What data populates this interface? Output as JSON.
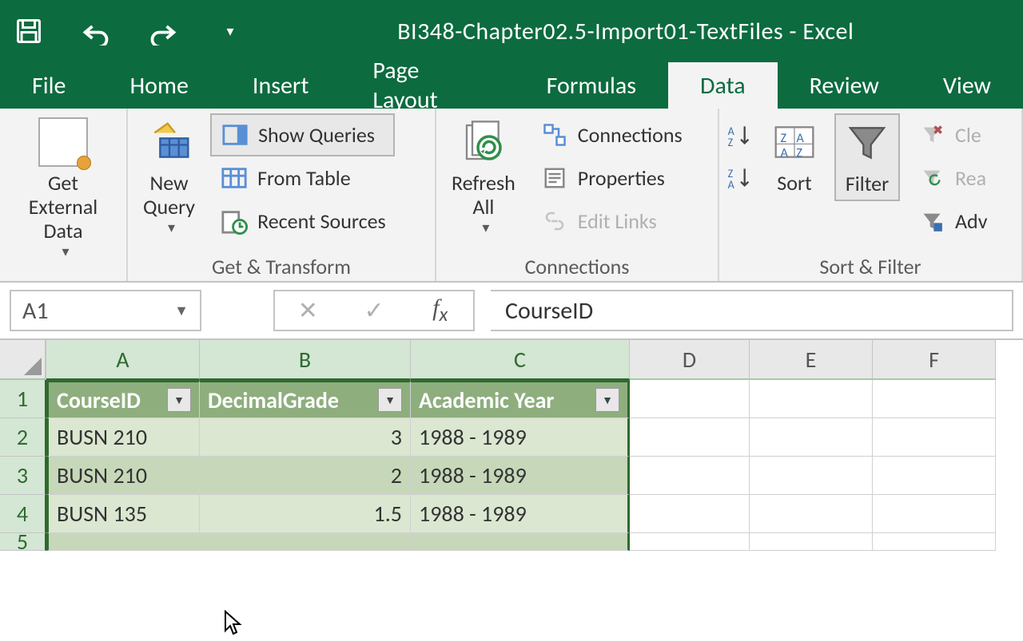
{
  "app": {
    "title": "BI348-Chapter02.5-Import01-TextFiles - Excel"
  },
  "tabs": [
    "File",
    "Home",
    "Insert",
    "Page Layout",
    "Formulas",
    "Data",
    "Review",
    "View"
  ],
  "active_tab": "Data",
  "ribbon": {
    "groups": {
      "external": {
        "get_external_data": "Get External\nData"
      },
      "transform": {
        "caption": "Get & Transform",
        "new_query": "New\nQuery",
        "show_queries": "Show Queries",
        "from_table": "From Table",
        "recent_sources": "Recent Sources"
      },
      "connections": {
        "caption": "Connections",
        "refresh_all": "Refresh\nAll",
        "connections": "Connections",
        "properties": "Properties",
        "edit_links": "Edit Links"
      },
      "sortfilter": {
        "caption": "Sort & Filter",
        "sort": "Sort",
        "filter": "Filter",
        "clear": "Cle",
        "reapply": "Rea",
        "advanced": "Adv"
      }
    }
  },
  "namebox": "A1",
  "formula_value": "CourseID",
  "columns": [
    "A",
    "B",
    "C",
    "D",
    "E",
    "F"
  ],
  "selected_cols": [
    "A",
    "B",
    "C"
  ],
  "row_numbers": [
    1,
    2,
    3,
    4,
    5
  ],
  "table": {
    "headers": [
      "CourseID",
      "DecimalGrade",
      "Academic Year"
    ],
    "rows": [
      {
        "course": "BUSN 210",
        "grade": "3",
        "year": "1988 - 1989"
      },
      {
        "course": "BUSN 210",
        "grade": "2",
        "year": "1988 - 1989"
      },
      {
        "course": "BUSN 135",
        "grade": "1.5",
        "year": "1988 - 1989"
      }
    ]
  }
}
